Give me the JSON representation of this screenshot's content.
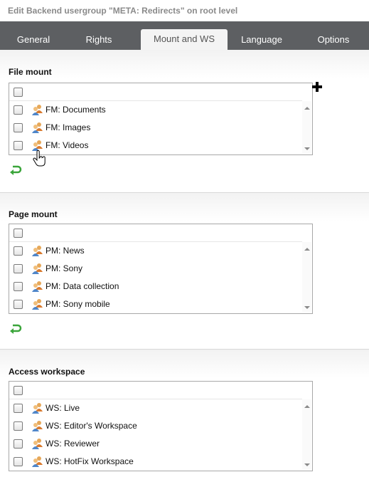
{
  "header": {
    "title": "Edit Backend usergroup \"META: Redirects\" on root level"
  },
  "tabs": [
    {
      "label": "General",
      "active": false
    },
    {
      "label": "Rights",
      "active": false
    },
    {
      "label": "Mount and WS",
      "active": true
    },
    {
      "label": "Language",
      "active": false
    },
    {
      "label": "Options",
      "active": false
    }
  ],
  "file_mount": {
    "title": "File mount",
    "items": [
      {
        "label": "FM: Documents",
        "checked": false
      },
      {
        "label": "FM: Images",
        "checked": false
      },
      {
        "label": "FM: Videos",
        "checked": false
      }
    ]
  },
  "page_mount": {
    "title": "Page mount",
    "items": [
      {
        "label": "PM: News",
        "checked": false
      },
      {
        "label": "PM: Sony",
        "checked": false
      },
      {
        "label": "PM: Data collection",
        "checked": false
      },
      {
        "label": "PM: Sony mobile",
        "checked": false
      }
    ]
  },
  "access_workspace": {
    "title": "Access workspace",
    "items": [
      {
        "label": "WS: Live",
        "checked": false
      },
      {
        "label": "WS: Editor's Workspace",
        "checked": false
      },
      {
        "label": "WS: Reviewer",
        "checked": false
      },
      {
        "label": "WS: HotFix Workspace",
        "checked": false
      }
    ]
  },
  "icons": {
    "usergroup": "usergroup-icon",
    "add": "plus-icon",
    "revert": "revert-arrow-icon",
    "cursor": "hand-cursor-icon"
  },
  "colors": {
    "tabbar_bg": "#5d5f62",
    "revert_green": "#3aa53a"
  }
}
